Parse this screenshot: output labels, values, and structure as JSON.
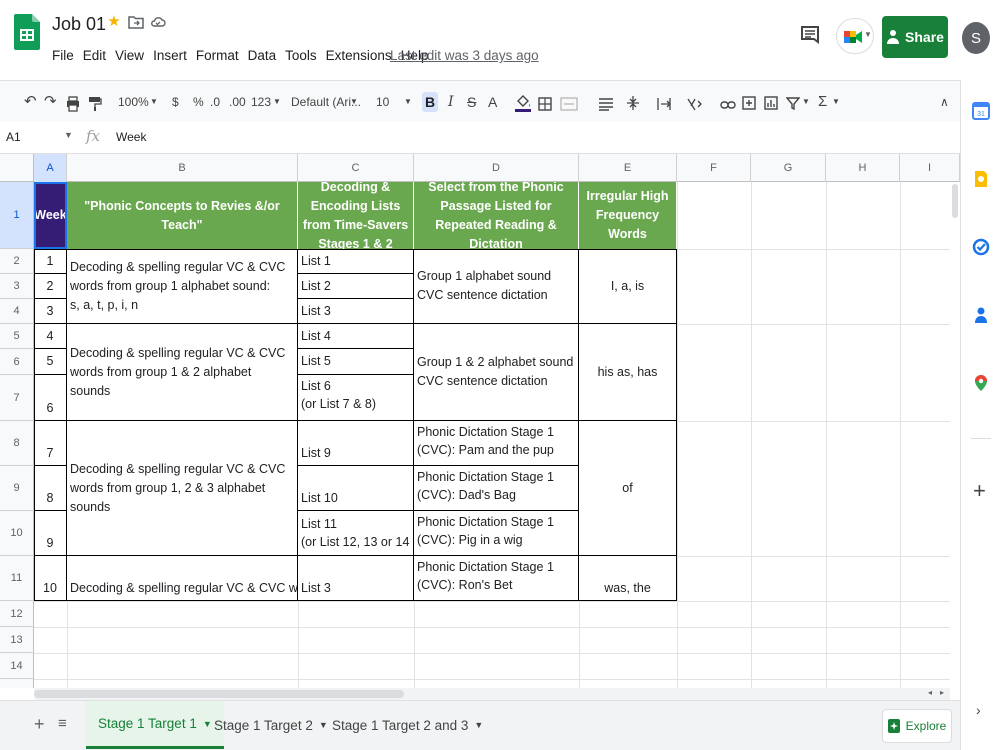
{
  "app": {
    "doc_title": "Job 01",
    "menu": [
      "File",
      "Edit",
      "View",
      "Insert",
      "Format",
      "Data",
      "Tools",
      "Extensions",
      "Help"
    ],
    "last_edit": "Last edit was 3 days ago",
    "share_label": "Share",
    "avatar_letter": "S",
    "brand_green": "#188038"
  },
  "toolbar": {
    "zoom": "100%",
    "currency": "$",
    "percent": "%",
    "decrease_decimal": ".0",
    "increase_decimal": ".00",
    "number_format": "123",
    "font": "Default (Ari...",
    "font_size": "10",
    "bold": "B",
    "italic": "I",
    "strike": "S"
  },
  "formula_bar": {
    "cell_ref": "A1",
    "fx": "fx",
    "value": "Week"
  },
  "grid": {
    "columns": [
      "A",
      "B",
      "C",
      "D",
      "E",
      "F",
      "G",
      "H",
      "I"
    ],
    "rows": [
      "1",
      "2",
      "3",
      "4",
      "5",
      "6",
      "7",
      "8",
      "9",
      "10",
      "11",
      "12",
      "13",
      "14"
    ],
    "header": {
      "a": "Week",
      "b": "\"Phonic Concepts to Revies &/or Teach\"",
      "c": "Decoding & Encoding Lists from Time-Savers Stages 1 & 2",
      "d": "Select from the Phonic Passage Listed for Repeated Reading & Dictation",
      "e": "Irregular High Frequency Words"
    },
    "week_numbers": [
      "1",
      "2",
      "3",
      "4",
      "5",
      "6",
      "7",
      "8",
      "9",
      "10"
    ],
    "concepts": [
      "Decoding & spelling regular VC & CVC words from group 1 alphabet sound:\ns, a, t, p, i, n",
      "Decoding & spelling regular VC & CVC words from group 1 & 2 alphabet sounds",
      "Decoding & spelling regular VC & CVC words from group 1, 2 & 3 alphabet sounds",
      "Decoding & spelling regular VC & CVC words from th"
    ],
    "lists": [
      "List 1",
      "List 2",
      "List 3",
      "List 4",
      "List 5",
      "List 6\n(or List 7 & 8)",
      "List 9",
      "List 10",
      "List 11\n(or List 12, 13 or 14",
      "List 3"
    ],
    "passages": [
      "Group 1 alphabet sound CVC sentence dictation",
      "Group 1 & 2 alphabet sound CVC sentence dictation",
      "Phonic Dictation Stage 1\n(CVC): Pam and the pup",
      "Phonic Dictation Stage 1\n(CVC): Dad's Bag",
      "Phonic Dictation Stage 1\n(CVC): Pig in a wig",
      "Phonic Dictation Stage 1\n(CVC): Ron's Bet"
    ],
    "words": [
      "I, a, is",
      "his as, has",
      "of",
      "was, the"
    ],
    "header_green": "#6aa84f",
    "week_purple": "#351c75"
  },
  "sheets": {
    "tabs": [
      "Stage 1 Target 1",
      "Stage 1 Target 2",
      "Stage 1 Target 2 and 3"
    ],
    "explore": "Explore"
  }
}
